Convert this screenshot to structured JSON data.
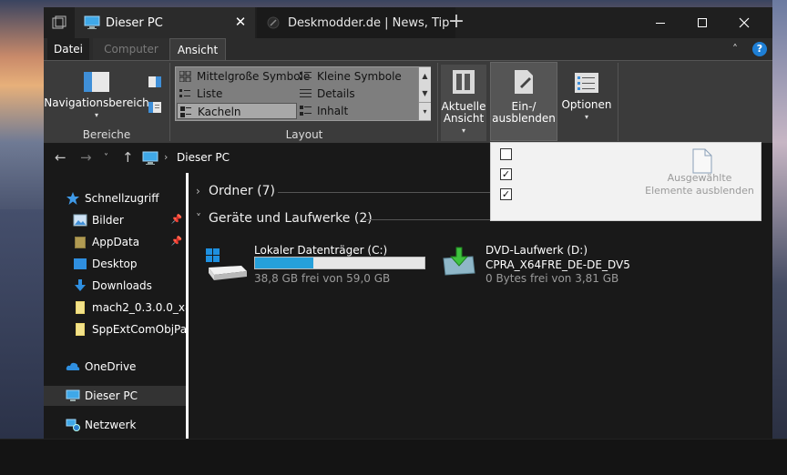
{
  "tabs": [
    {
      "title": "Dieser PC",
      "active": true
    },
    {
      "title": "Deskmodder.de | News, Tip",
      "active": false
    }
  ],
  "ribbon_tabs": {
    "file": "Datei",
    "computer": "Computer",
    "view": "Ansicht"
  },
  "ribbon": {
    "nav_pane": "Navigationsbereich",
    "panes_group": "Bereiche",
    "layout_group": "Layout",
    "layout_items": [
      "Mittelgroße Symbole",
      "Kleine Symbole",
      "Liste",
      "Details",
      "Kacheln",
      "Inhalt"
    ],
    "layout_selected": "Kacheln",
    "current_view_line1": "Aktuelle",
    "current_view_line2": "Ansicht",
    "show_hide_line1": "Ein-/",
    "show_hide_line2": "ausblenden",
    "options": "Optionen"
  },
  "address": {
    "crumb": "Dieser PC"
  },
  "popup": {
    "checkboxes": [
      {
        "checked": false
      },
      {
        "checked": true
      },
      {
        "checked": true
      }
    ],
    "hide_selected_line1": "Ausgewählte",
    "hide_selected_line2": "Elemente ausblenden"
  },
  "sidebar": {
    "items": [
      {
        "label": "Schnellzugriff",
        "icon": "star-icon",
        "pinned": false
      },
      {
        "label": "Bilder",
        "icon": "pictures-icon",
        "pinned": true
      },
      {
        "label": "AppData",
        "icon": "folder-icon",
        "pinned": true
      },
      {
        "label": "Desktop",
        "icon": "desktop-icon",
        "pinned": false
      },
      {
        "label": "Downloads",
        "icon": "download-icon",
        "pinned": false
      },
      {
        "label": "mach2_0.3.0.0_x86",
        "icon": "folder-icon",
        "pinned": false
      },
      {
        "label": "SppExtComObjPatc",
        "icon": "folder-icon",
        "pinned": false
      },
      {
        "label": "OneDrive",
        "icon": "cloud-icon",
        "pinned": false
      },
      {
        "label": "Dieser PC",
        "icon": "computer-icon",
        "pinned": false
      },
      {
        "label": "Netzwerk",
        "icon": "network-icon",
        "pinned": false
      }
    ]
  },
  "content": {
    "folders_group": "Ordner (7)",
    "drives_group": "Geräte und Laufwerke (2)",
    "drives": [
      {
        "name": "Lokaler Datenträger (C:)",
        "label": "",
        "free": "38,8 GB frei von 59,0 GB",
        "used_fraction": 0.342
      },
      {
        "name": "DVD-Laufwerk (D:)",
        "label": "CPRA_X64FRE_DE-DE_DV5",
        "free": "0 Bytes frei von 3,81 GB"
      }
    ]
  },
  "colors": {
    "accent": "#26a0da",
    "ribbon": "#3b3b3b",
    "window": "#191919"
  }
}
